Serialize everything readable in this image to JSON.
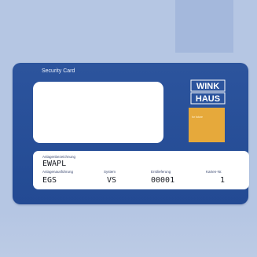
{
  "card": {
    "title": "Security Card",
    "brand_top": "WINK",
    "brand_bottom": "HAUS",
    "brand_tagline": "for future"
  },
  "fields": {
    "designation_label": "Anlagenbezeichnung",
    "designation_value": "EWAPL",
    "design_label": "Anlagenausführung",
    "design_value": "EGS",
    "system_label": "System",
    "system_value": "VS",
    "delivery_label": "Erstlieferung",
    "delivery_value": "00001",
    "card_no_label": "Karten-Nr.",
    "card_no_value": "1"
  },
  "colors": {
    "background": "#b5c6e3",
    "card_blue": "#2c549d",
    "brand_yellow": "#e6a93b"
  }
}
